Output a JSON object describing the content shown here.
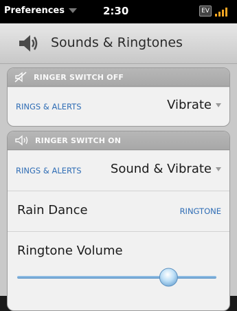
{
  "status_bar": {
    "app_name": "Preferences",
    "time": "2:30",
    "ev_badge": "EV",
    "signal_icon": "signal-bars-icon"
  },
  "header": {
    "icon": "sounds-speaker-icon",
    "title": "Sounds & Ringtones"
  },
  "ringer_off": {
    "heading": "RINGER SWITCH OFF",
    "icon": "muted-speaker-icon",
    "rings_alerts_label": "RINGS & ALERTS",
    "rings_alerts_value": "Vibrate"
  },
  "ringer_on": {
    "heading": "RINGER SWITCH ON",
    "icon": "speaker-waves-icon",
    "rings_alerts_label": "RINGS & ALERTS",
    "rings_alerts_value": "Sound & Vibrate",
    "ringtone_name": "Rain Dance",
    "ringtone_label": "RINGTONE",
    "volume_label": "Ringtone Volume",
    "volume_level_percent": 76
  },
  "colors": {
    "accent_blue": "#2f6db5",
    "slider_knob": "#8fbfe8"
  }
}
